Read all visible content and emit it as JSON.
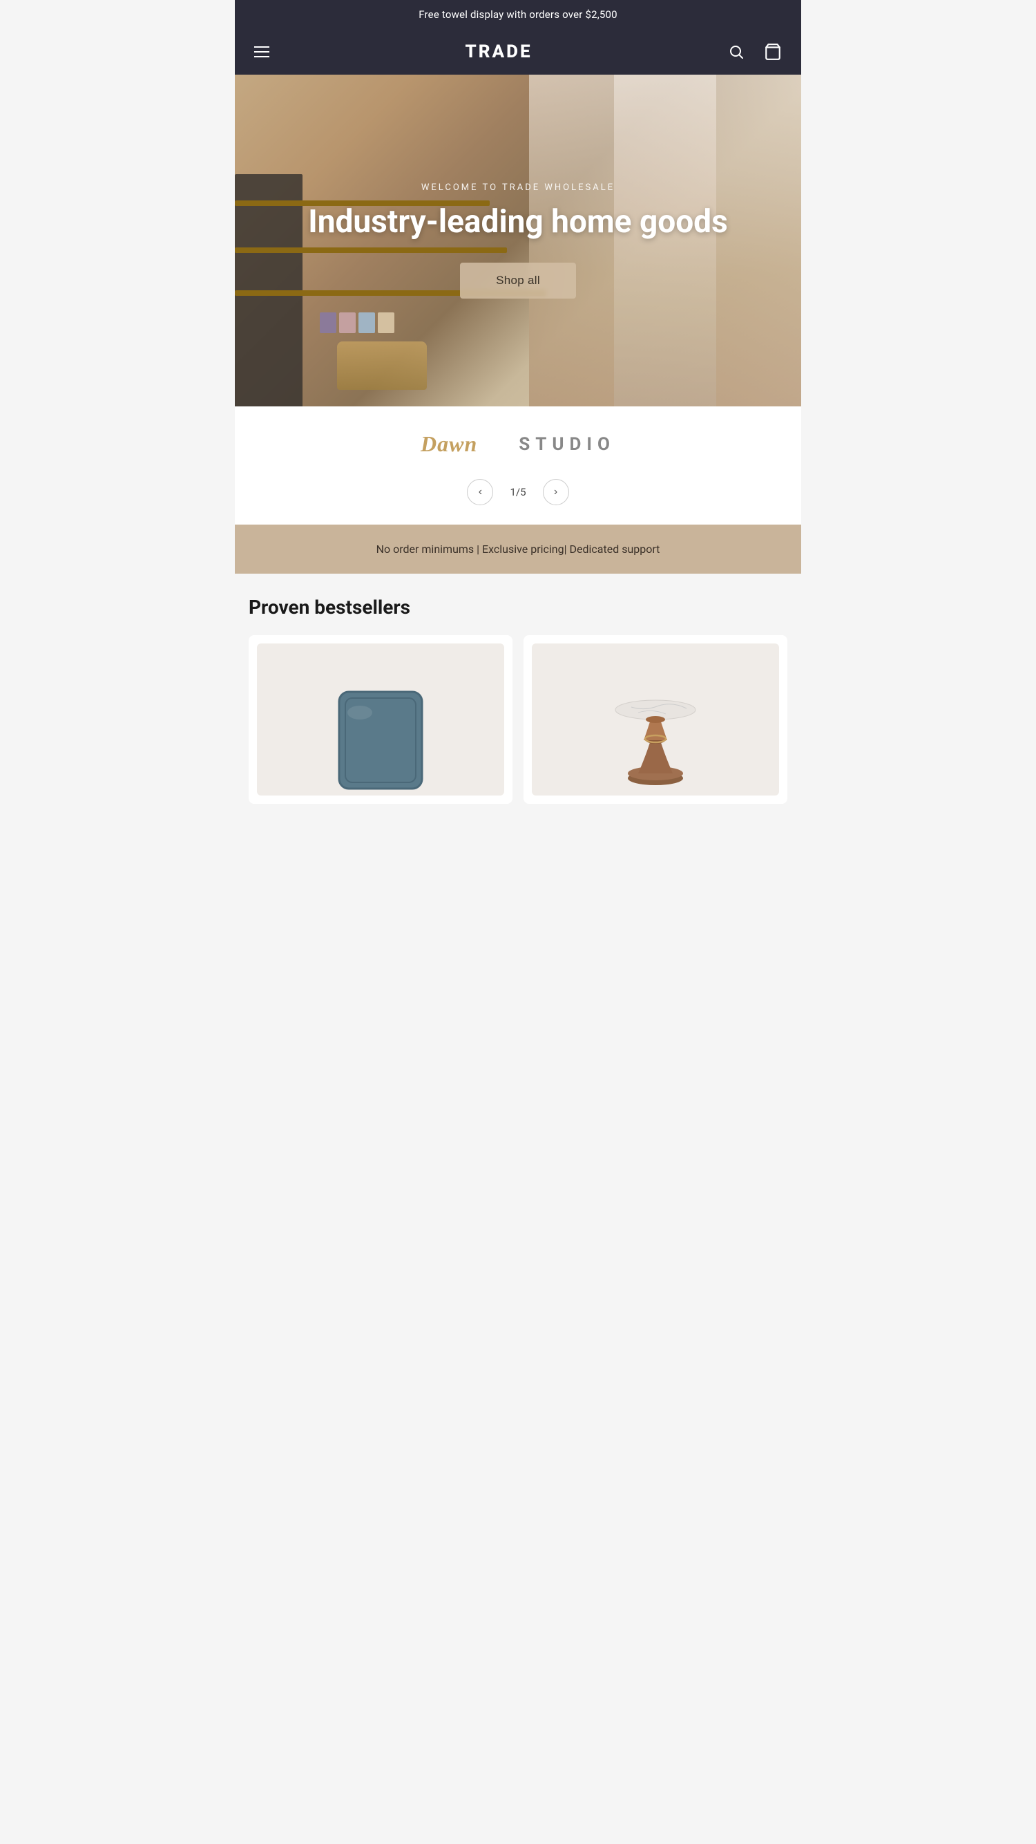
{
  "announcement": {
    "text": "Free towel display with orders over $2,500"
  },
  "header": {
    "logo": "TRADE",
    "menu_icon": "menu-icon",
    "search_icon": "search-icon",
    "cart_icon": "cart-icon"
  },
  "hero": {
    "subtitle": "WELCOME TO TRADE WHOLESALE",
    "title": "Industry-leading home goods",
    "cta_label": "Shop all"
  },
  "brands": [
    {
      "name": "Dawn",
      "style": "serif-italic"
    },
    {
      "name": "STUDIO",
      "style": "uppercase"
    }
  ],
  "carousel": {
    "current": "1",
    "total": "5",
    "indicator": "1/5",
    "prev_label": "‹",
    "next_label": "›"
  },
  "benefits": {
    "text": "No order minimums | Exclusive pricing| Dedicated support"
  },
  "products_section": {
    "title": "Proven bestsellers",
    "products": [
      {
        "id": "pillow",
        "alt": "Blue linen pillow"
      },
      {
        "id": "side-table",
        "alt": "Marble and wood side table"
      }
    ]
  }
}
